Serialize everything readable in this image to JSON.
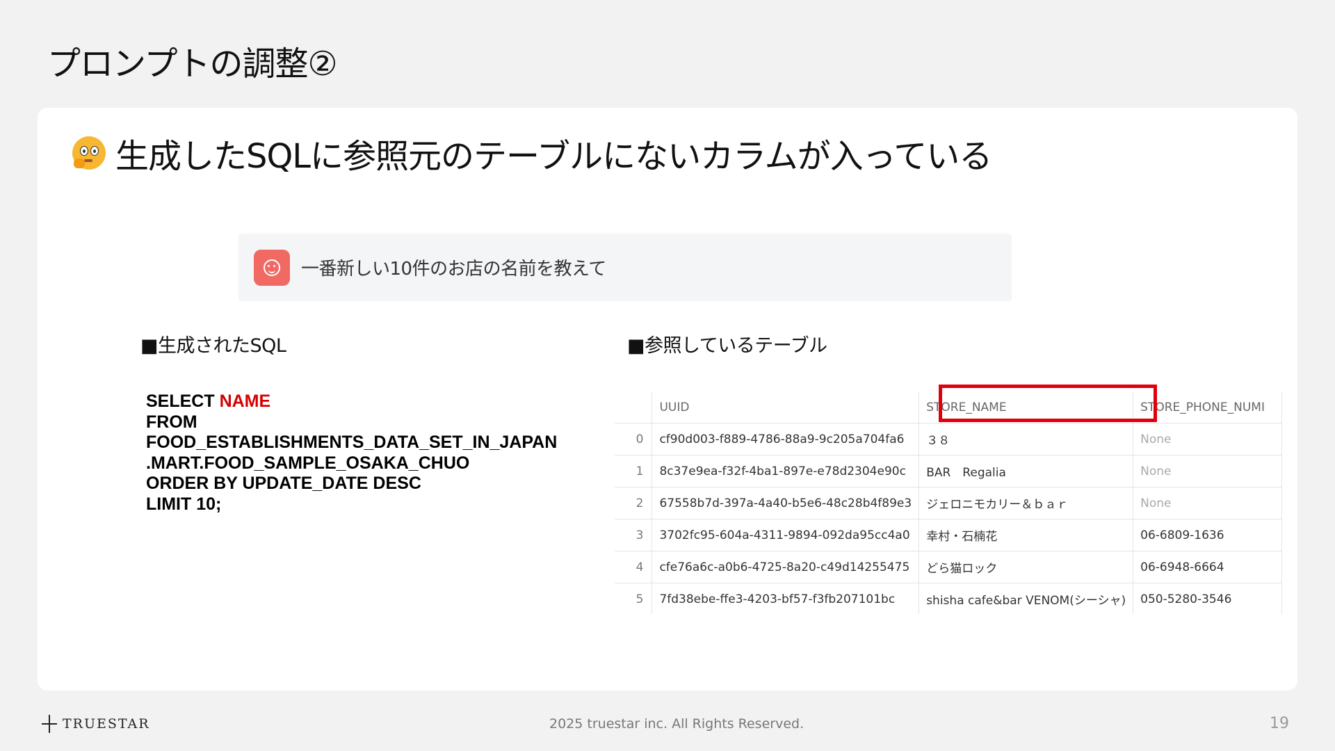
{
  "title": "プロンプトの調整②",
  "issue": {
    "icon": "thinking-face-icon",
    "text": "生成したSQLに参照元のテーブルにないカラムが入っている"
  },
  "prompt": {
    "icon": "chat-avatar-icon",
    "text": "一番新しい10件のお店の名前を教えて"
  },
  "sql_section": {
    "label": "■生成されたSQL",
    "lines": [
      {
        "keyword": "SELECT ",
        "highlight": "NAME"
      },
      {
        "text": "FROM"
      },
      {
        "text": "FOOD_ESTABLISHMENTS_DATA_SET_IN_JAPAN"
      },
      {
        "text": ".MART.FOOD_SAMPLE_OSAKA_CHUO"
      },
      {
        "text": "ORDER BY UPDATE_DATE DESC"
      },
      {
        "text": "LIMIT 10;"
      }
    ]
  },
  "table_section": {
    "label": "■参照しているテーブル",
    "columns": [
      "",
      "UUID",
      "STORE_NAME",
      "STORE_PHONE_NUMI"
    ],
    "rows": [
      [
        "0",
        "cf90d003-f889-4786-88a9-9c205a704fa6",
        "３８",
        "None"
      ],
      [
        "1",
        "8c37e9ea-f32f-4ba1-897e-e78d2304e90c",
        "BAR　Regalia",
        "None"
      ],
      [
        "2",
        "67558b7d-397a-4a40-b5e6-48c28b4f89e3",
        "ジェロニモカリー＆ｂａｒ",
        "None"
      ],
      [
        "3",
        "3702fc95-604a-4311-9894-092da95cc4a0",
        "幸村・石楠花",
        "06-6809-1636"
      ],
      [
        "4",
        "cfe76a6c-a0b6-4725-8a20-c49d14255475",
        "どら猫ロック",
        "06-6948-6664"
      ],
      [
        "5",
        "7fd38ebe-ffe3-4203-bf57-f3fb207101bc",
        "shisha cafe&bar VENOM(シーシャ)",
        "050-5280-3546"
      ]
    ]
  },
  "colors": {
    "highlight_red": "#e0000b",
    "sql_red": "#d40000",
    "avatar": "#f06a63"
  },
  "footer": {
    "logo": "TRUESTAR",
    "copyright": "2025 truestar inc. All Rights Reserved.",
    "page_number": "19"
  }
}
